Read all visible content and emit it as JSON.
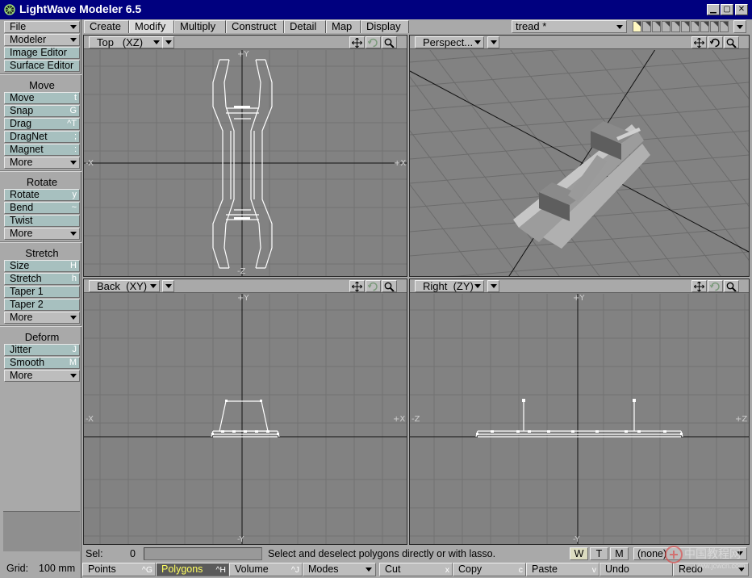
{
  "window": {
    "title": "LightWave Modeler 6.5"
  },
  "left_toolbar": {
    "menus": [
      {
        "label": "File"
      },
      {
        "label": "Modeler"
      }
    ],
    "editors": [
      {
        "label": "Image Editor"
      },
      {
        "label": "Surface Editor"
      }
    ],
    "groups": [
      {
        "header": "Move",
        "tools": [
          {
            "label": "Move",
            "shortcut": "t"
          },
          {
            "label": "Snap",
            "shortcut": "G"
          },
          {
            "label": "Drag",
            "shortcut": "^T"
          },
          {
            "label": "DragNet",
            "shortcut": ";"
          },
          {
            "label": "Magnet",
            "shortcut": ":"
          },
          {
            "label": "More",
            "shortcut": ""
          }
        ]
      },
      {
        "header": "Rotate",
        "tools": [
          {
            "label": "Rotate",
            "shortcut": "y"
          },
          {
            "label": "Bend",
            "shortcut": "~"
          },
          {
            "label": "Twist",
            "shortcut": ""
          },
          {
            "label": "More",
            "shortcut": ""
          }
        ]
      },
      {
        "header": "Stretch",
        "tools": [
          {
            "label": "Size",
            "shortcut": "H"
          },
          {
            "label": "Stretch",
            "shortcut": "h"
          },
          {
            "label": "Taper 1",
            "shortcut": ""
          },
          {
            "label": "Taper 2",
            "shortcut": ""
          },
          {
            "label": "More",
            "shortcut": ""
          }
        ]
      },
      {
        "header": "Deform",
        "tools": [
          {
            "label": "Jitter",
            "shortcut": "J"
          },
          {
            "label": "Smooth",
            "shortcut": "M"
          },
          {
            "label": "More",
            "shortcut": ""
          }
        ]
      }
    ],
    "grid": {
      "label": "Grid:",
      "value": "100 mm"
    }
  },
  "tabs": [
    {
      "label": "Create"
    },
    {
      "label": "Modify"
    },
    {
      "label": "Multiply"
    },
    {
      "label": "Construct"
    },
    {
      "label": "Detail"
    },
    {
      "label": "Map"
    },
    {
      "label": "Display"
    }
  ],
  "active_tab": "Modify",
  "object": {
    "name": "tread *"
  },
  "viewports": [
    {
      "title": "Top   (XZ)",
      "axes": {
        "left": "-X",
        "right": "+X",
        "top": "+Y",
        "bottom": "-Z"
      }
    },
    {
      "title": "Perspect...",
      "axes": {}
    },
    {
      "title": "Back  (XY)",
      "axes": {
        "left": "-X",
        "right": "+X",
        "top": "+Y",
        "bottom": "-Y"
      }
    },
    {
      "title": "Right  (ZY)",
      "axes": {
        "left": "-Z",
        "right": "+Z",
        "top": "+Y",
        "bottom": "-Y"
      }
    }
  ],
  "status": {
    "sel_label": "Sel:",
    "sel_count": "0",
    "help_text": "Select and deselect polygons directly or with lasso.",
    "modes": [
      "W",
      "T",
      "M"
    ],
    "active_mode": "W",
    "surface": "(none)"
  },
  "command_bar": [
    {
      "label": "Points",
      "shortcut": "^G"
    },
    {
      "label": "Polygons",
      "shortcut": "^H"
    },
    {
      "label": "Volume",
      "shortcut": "^J"
    },
    {
      "label": "Modes",
      "shortcut": ""
    },
    {
      "label": "Cut",
      "shortcut": "x"
    },
    {
      "label": "Copy",
      "shortcut": "c"
    },
    {
      "label": "Paste",
      "shortcut": "v"
    },
    {
      "label": "Undo",
      "shortcut": ""
    },
    {
      "label": "Redo",
      "shortcut": ""
    }
  ],
  "active_selection_mode": "Polygons",
  "watermark": {
    "line1": "中国教程网",
    "line2": "www.jcwcn.com"
  },
  "colors": {
    "title_bar": "#00007f",
    "viewport_bg": "#828282",
    "grid_line": "#727272",
    "wire": "#ffffff",
    "mesh_solid": "#c8c8c8"
  }
}
